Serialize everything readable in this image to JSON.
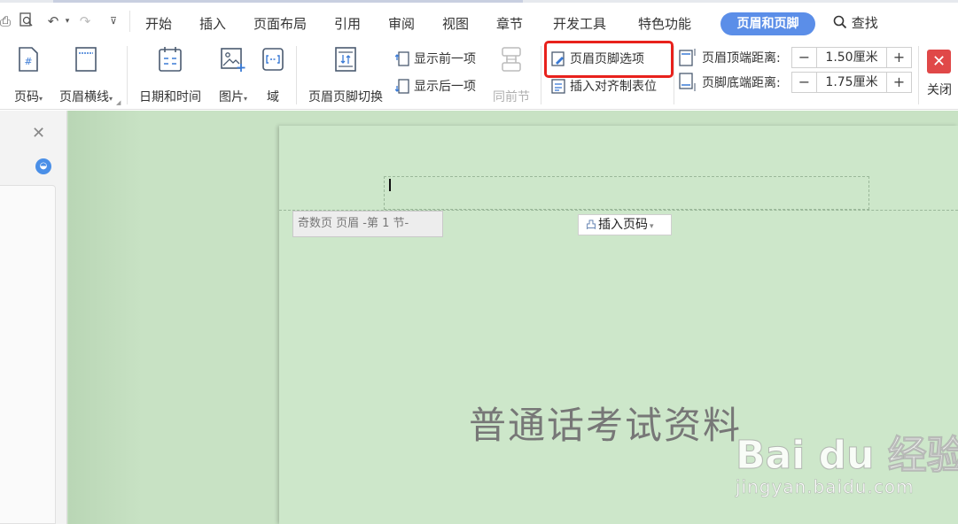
{
  "menu": {
    "items": [
      "开始",
      "插入",
      "页面布局",
      "引用",
      "审阅",
      "视图",
      "章节",
      "开发工具",
      "特色功能"
    ],
    "active": "页眉和页脚",
    "search": "查找"
  },
  "ribbon": {
    "page_number": "页码",
    "header_line": "页眉横线",
    "date_time": "日期和时间",
    "picture": "图片",
    "field": "域",
    "switch": "页眉页脚切换",
    "show_prev": "显示前一项",
    "show_next": "显示后一项",
    "same_as_prev": "同前节",
    "options": "页眉页脚选项",
    "insert_align_tab": "插入对齐制表位",
    "header_top_label": "页眉顶端距离:",
    "header_top_value": "1.50厘米",
    "footer_bottom_label": "页脚底端距离:",
    "footer_bottom_value": "1.75厘米",
    "close": "关闭"
  },
  "document": {
    "odd_header_label": "奇数页 页眉  -第 1 节-",
    "insert_page_number": "插入页码",
    "body_title": "普通话考试资料"
  },
  "watermark": {
    "brand": "Bai du 经验",
    "url": "jingyan.baidu.com"
  },
  "colors": {
    "accent": "#5b8ee8",
    "highlight": "#e8211c",
    "page_bg": "#cde7ca",
    "close_bg": "#e04848"
  }
}
